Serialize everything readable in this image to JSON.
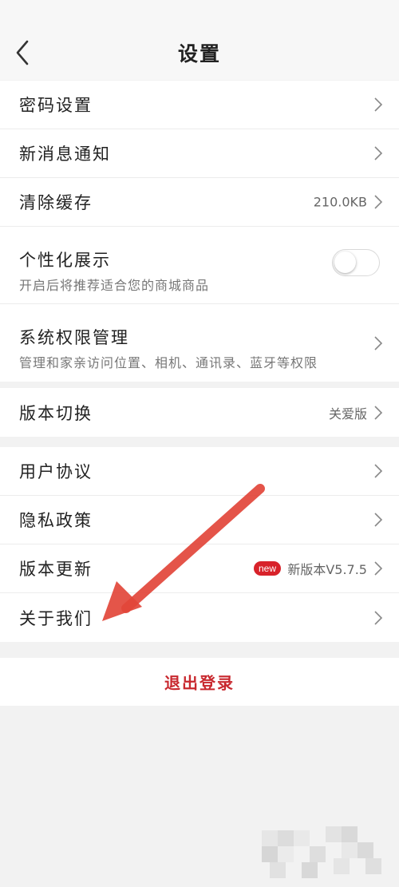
{
  "header": {
    "title": "设置",
    "back_icon": "chevron-left-icon"
  },
  "group1": {
    "password": {
      "label": "密码设置"
    },
    "notification": {
      "label": "新消息通知"
    },
    "cache": {
      "label": "清除缓存",
      "value": "210.0KB"
    },
    "personalize": {
      "label": "个性化展示",
      "sub": "开启后将推荐适合您的商城商品",
      "toggle_on": false
    },
    "permissions": {
      "label": "系统权限管理",
      "sub": "管理和家亲访问位置、相机、通讯录、蓝牙等权限"
    }
  },
  "group2": {
    "version_switch": {
      "label": "版本切换",
      "value": "关爱版"
    }
  },
  "group3": {
    "agreement": {
      "label": "用户协议"
    },
    "privacy": {
      "label": "隐私政策"
    },
    "update": {
      "label": "版本更新",
      "badge": "new",
      "value": "新版本V5.7.5"
    },
    "about": {
      "label": "关于我们"
    }
  },
  "logout": {
    "label": "退出登录"
  },
  "colors": {
    "accent_red": "#c8282e",
    "badge_red": "#d8222a",
    "annotation_arrow": "#e2463a"
  }
}
